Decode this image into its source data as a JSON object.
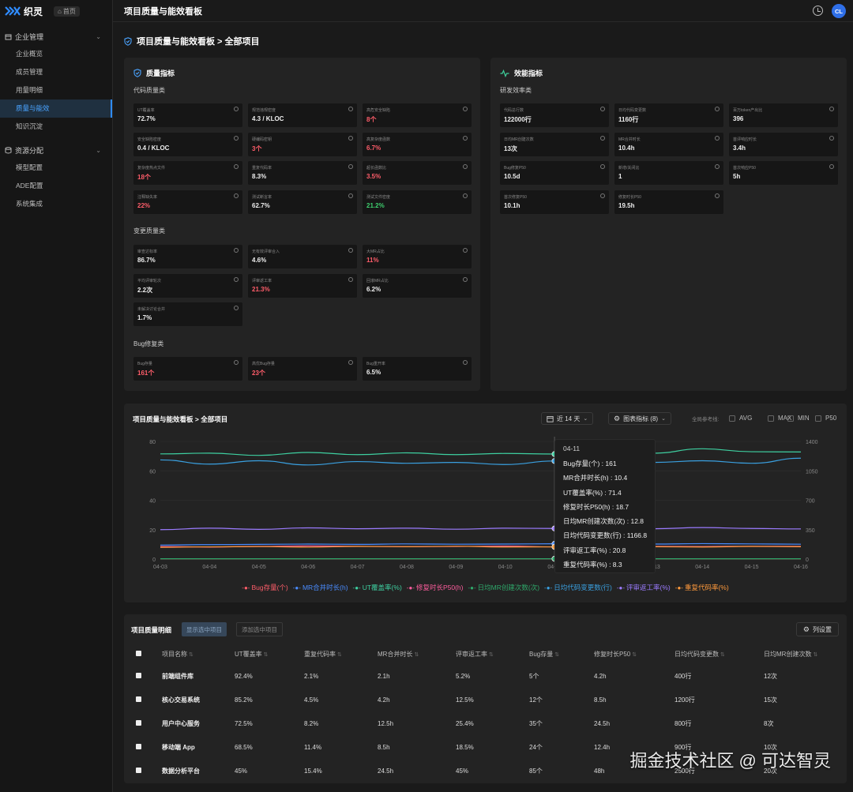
{
  "brand": {
    "name": "织灵",
    "home_chip": "首页"
  },
  "sidebar": {
    "groups": [
      {
        "title": "企业管理",
        "items": [
          "企业概览",
          "成员管理",
          "用量明细",
          "质量与能效",
          "知识沉淀"
        ]
      },
      {
        "title": "资源分配",
        "items": [
          "模型配置",
          "ADE配置",
          "系统集成"
        ]
      }
    ],
    "active_item": "质量与能效"
  },
  "topbar": {
    "title": "项目质量与能效看板",
    "avatar": "CL"
  },
  "page": {
    "title": "项目质量与能效看板 > 全部项目"
  },
  "quality": {
    "title": "质量指标",
    "sections": [
      {
        "label": "代码质量类",
        "cards": [
          {
            "label": "UT覆盖率",
            "value": "72.7%",
            "tone": "normal"
          },
          {
            "label": "规范违规密度",
            "value": "4.3 / KLOC",
            "tone": "normal"
          },
          {
            "label": "高危安全缺陷",
            "value": "8个",
            "tone": "red"
          },
          {
            "label": "安全缺陷密度",
            "value": "0.4 / KLOC",
            "tone": "normal"
          },
          {
            "label": "硬编码密钥",
            "value": "3个",
            "tone": "red"
          },
          {
            "label": "高复杂度函数",
            "value": "6.7%",
            "tone": "red"
          },
          {
            "label": "复杂度热点文件",
            "value": "18个",
            "tone": "red"
          },
          {
            "label": "重复代码率",
            "value": "8.3%",
            "tone": "normal"
          },
          {
            "label": "超长函数比",
            "value": "3.5%",
            "tone": "red"
          },
          {
            "label": "注释缺失率",
            "value": "22%",
            "tone": "red"
          },
          {
            "label": "测试断言率",
            "value": "62.7%",
            "tone": "normal"
          },
          {
            "label": "测试文件密度",
            "value": "21.2%",
            "tone": "green"
          }
        ]
      },
      {
        "label": "变更质量类",
        "cards": [
          {
            "label": "审查达标率",
            "value": "86.7%",
            "tone": "normal"
          },
          {
            "label": "无有效评审合入",
            "value": "4.6%",
            "tone": "normal"
          },
          {
            "label": "大MR占比",
            "value": "11%",
            "tone": "red"
          },
          {
            "label": "平均评审轮次",
            "value": "2.2次",
            "tone": "normal"
          },
          {
            "label": "评审返工率",
            "value": "21.3%",
            "tone": "red"
          },
          {
            "label": "回滚MR占比",
            "value": "6.2%",
            "tone": "normal"
          },
          {
            "label": "未解决讨论合并",
            "value": "1.7%",
            "tone": "normal"
          }
        ]
      },
      {
        "label": "Bug修复类",
        "cards": [
          {
            "label": "Bug存量",
            "value": "161个",
            "tone": "red"
          },
          {
            "label": "高优Bug存量",
            "value": "23个",
            "tone": "red"
          },
          {
            "label": "Bug重开率",
            "value": "6.5%",
            "tone": "normal"
          }
        ]
      }
    ]
  },
  "efficiency": {
    "title": "效能指标",
    "section_label": "研发效率类",
    "cards": [
      {
        "label": "代码总行数",
        "value": "122000行"
      },
      {
        "label": "日均代码变更数",
        "value": "1160行"
      },
      {
        "label": "百万token产出比",
        "value": "396"
      },
      {
        "label": "日均MR创建次数",
        "value": "13次"
      },
      {
        "label": "MR合并时长",
        "value": "10.4h"
      },
      {
        "label": "首评响应时长",
        "value": "3.4h"
      },
      {
        "label": "Bug修复P50",
        "value": "10.5d"
      },
      {
        "label": "新增/关闭比",
        "value": "1"
      },
      {
        "label": "首次响应P50",
        "value": "5h"
      },
      {
        "label": "首次修复P50",
        "value": "10.1h"
      },
      {
        "label": "修复时长P50",
        "value": "19.5h"
      }
    ]
  },
  "chart_panel": {
    "title": "项目质量与能效看板 > 全部项目",
    "date_range": "近 14 天",
    "metrics_btn": "图表指标 (8)",
    "ref_label": "全局参考线:",
    "ref_lines": [
      "AVG",
      "MAX",
      "MIN",
      "P50"
    ]
  },
  "chart_data": {
    "type": "line",
    "x": [
      "04-03",
      "04-04",
      "04-05",
      "04-06",
      "04-07",
      "04-08",
      "04-09",
      "04-10",
      "04-11",
      "04-12",
      "04-13",
      "04-14",
      "04-15",
      "04-16"
    ],
    "y_left_ticks": [
      0,
      20,
      40,
      60,
      80
    ],
    "y_right_ticks": [
      0,
      350,
      700,
      1050,
      1400
    ],
    "ylim_left": [
      0,
      80
    ],
    "ylim_right": [
      0,
      1400
    ],
    "series": [
      {
        "name": "Bug存量(个)",
        "color": "#ff5d6a",
        "axis": "left",
        "values": [
          0.2,
          0.2,
          0.2,
          0.2,
          0.2,
          0.2,
          0.2,
          0.2,
          0.2,
          0.2,
          0.2,
          0.2,
          0.2,
          0.2
        ]
      },
      {
        "name": "MR合并时长(h)",
        "color": "#4a8cff",
        "axis": "left",
        "values": [
          9.5,
          9.8,
          10.0,
          10.2,
          10.0,
          10.3,
          10.1,
          10.2,
          10.4,
          10.0,
          10.2,
          10.5,
          10.3,
          10.1
        ]
      },
      {
        "name": "UT覆盖率(%)",
        "color": "#3ecfa0",
        "axis": "left",
        "values": [
          71.5,
          72.0,
          70.5,
          72.5,
          71.0,
          72.2,
          71.0,
          71.8,
          71.4,
          73.5,
          72.0,
          75.0,
          73.0,
          72.8
        ]
      },
      {
        "name": "修复时长P50(h)",
        "color": "#ff5d9e",
        "axis": "left",
        "values": [
          8.5,
          8.2,
          8.6,
          8.9,
          8.7,
          8.4,
          8.6,
          8.8,
          8.3,
          8.7,
          8.6,
          8.5,
          8.7,
          8.6
        ]
      },
      {
        "name": "日均MR创建次数(次)",
        "color": "#2ea86a",
        "axis": "left",
        "values": [
          0.2,
          0.2,
          0.2,
          0.2,
          0.2,
          0.2,
          0.2,
          0.2,
          0.2,
          0.2,
          0.2,
          0.2,
          0.2,
          0.2
        ]
      },
      {
        "name": "日均代码变更数(行)",
        "color": "#3aa0e0",
        "axis": "right",
        "values": [
          1180,
          1130,
          1170,
          1120,
          1160,
          1140,
          1150,
          1125,
          1166.8,
          1130,
          1150,
          1170,
          1140,
          1200
        ]
      },
      {
        "name": "评审返工率(%)",
        "color": "#9b7bff",
        "axis": "left",
        "values": [
          20.0,
          21.0,
          20.2,
          21.2,
          20.6,
          21.0,
          20.3,
          21.0,
          20.8,
          20.4,
          20.6,
          21.4,
          20.8,
          20.5
        ]
      },
      {
        "name": "重复代码率(%)",
        "color": "#ff9a3c",
        "axis": "left",
        "values": [
          8.0,
          8.3,
          8.5,
          8.1,
          8.6,
          8.4,
          8.7,
          8.2,
          8.3,
          8.5,
          8.4,
          8.2,
          8.6,
          8.4
        ]
      }
    ],
    "tooltip": {
      "date": "04-11",
      "rows": [
        "Bug存量(个) : 161",
        "MR合并时长(h) : 10.4",
        "UT覆盖率(%) : 71.4",
        "修复时长P50(h) : 18.7",
        "日均MR创建次数(次) : 12.8",
        "日均代码变更数(行) : 1166.8",
        "评审返工率(%) : 20.8",
        "重复代码率(%) : 8.3"
      ]
    }
  },
  "table": {
    "title": "项目质量明细",
    "btn_show_selected": "显示选中项目",
    "btn_add_selected": "添加选中项目",
    "btn_columns": "列设置",
    "columns": [
      "项目名称",
      "UT覆盖率",
      "重复代码率",
      "MR合并时长",
      "评审返工率",
      "Bug存量",
      "修复时长P50",
      "日均代码变更数",
      "日均MR创建次数"
    ],
    "rows": [
      [
        "前端组件库",
        "92.4%",
        "2.1%",
        "2.1h",
        "5.2%",
        "5个",
        "4.2h",
        "400行",
        "12次"
      ],
      [
        "核心交易系统",
        "85.2%",
        "4.5%",
        "4.2h",
        "12.5%",
        "12个",
        "8.5h",
        "1200行",
        "15次"
      ],
      [
        "用户中心服务",
        "72.5%",
        "8.2%",
        "12.5h",
        "25.4%",
        "35个",
        "24.5h",
        "800行",
        "8次"
      ],
      [
        "移动端 App",
        "68.5%",
        "11.4%",
        "8.5h",
        "18.5%",
        "24个",
        "12.4h",
        "900行",
        "10次"
      ],
      [
        "数据分析平台",
        "45%",
        "15.4%",
        "24.5h",
        "45%",
        "85个",
        "48h",
        "2500行",
        "20次"
      ]
    ]
  },
  "watermark": "掘金技术社区 @ 可达智灵"
}
